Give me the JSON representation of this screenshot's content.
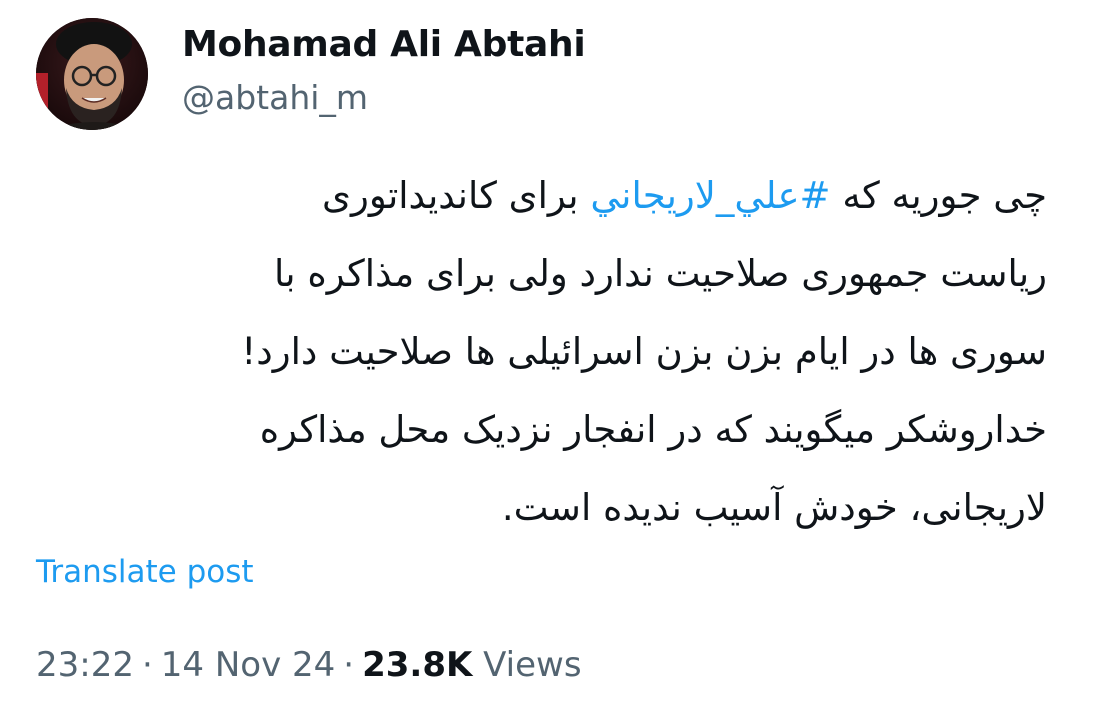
{
  "author": {
    "display_name": "Mohamad Ali Abtahi",
    "handle": "@abtahi_m"
  },
  "post": {
    "line1_before": "چی جوریه که ",
    "hashtag": "#علي_لاريجاني",
    "line1_after": "  برای کاندیداتوری",
    "line2": "ریاست جمهوری صلاحیت ندارد ولی برای مذاکره با",
    "line3": "سوری ها در ایام بزن بزن اسرائیلی ها صلاحیت دارد!",
    "line4": "خداروشکر میگویند که در انفجار نزدیک محل مذاکره",
    "line5": "لاریجانی، خودش آسیب ندیده است."
  },
  "translate_label": "Translate post",
  "meta": {
    "time": "23:22",
    "date": "14 Nov 24",
    "views_count": "23.8K",
    "views_label": "Views",
    "separator": "·"
  },
  "colors": {
    "link": "#1d9bf0",
    "secondary_text": "#536471",
    "primary_text": "#0f1419"
  }
}
